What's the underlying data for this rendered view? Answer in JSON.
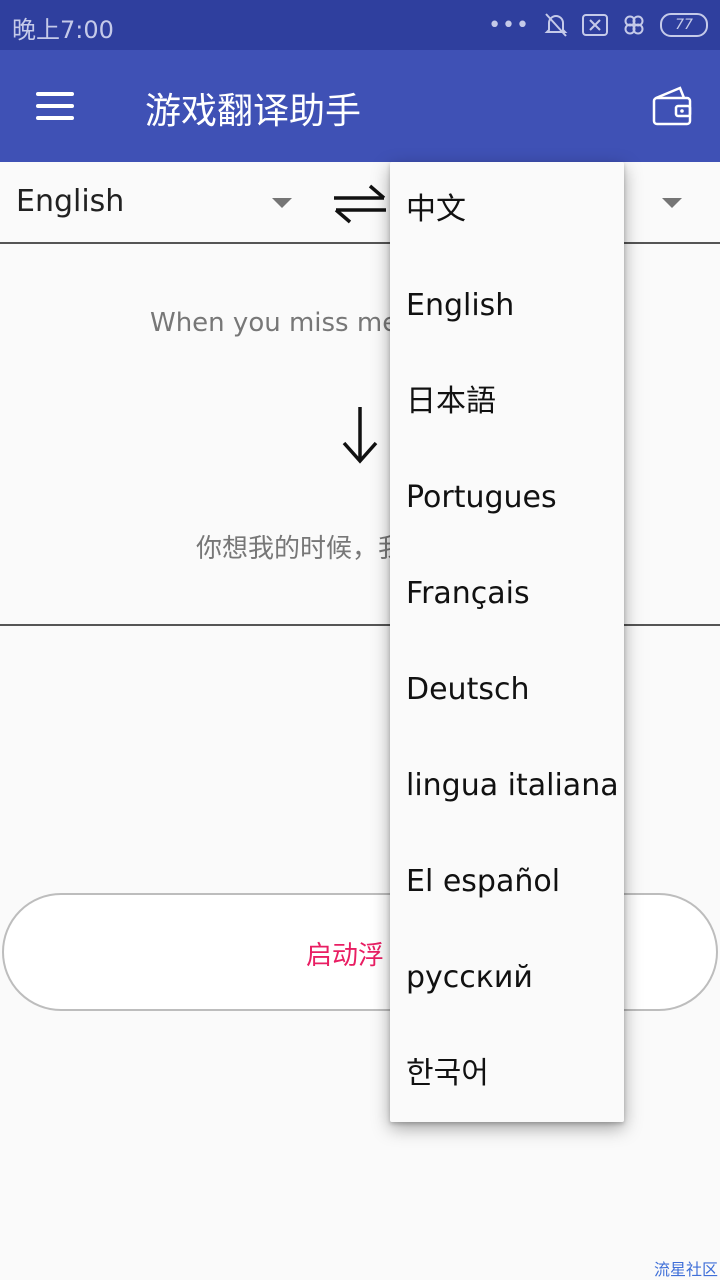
{
  "status_bar": {
    "time": "晚上7:00",
    "battery": "77",
    "icons": [
      "more-dots-icon",
      "mute-bell-icon",
      "sim-x-icon",
      "clover-icon",
      "battery-icon"
    ]
  },
  "toolbar": {
    "title": "游戏翻译助手",
    "menu_icon": "hamburger-menu-icon",
    "right_icon": "wallet-icon",
    "color": "#3f51b5"
  },
  "language_bar": {
    "source_language": "English",
    "swap_icon": "swap-arrows-icon"
  },
  "translation": {
    "source_text": "When you miss me,",
    "arrow_icon": "arrow-down-icon",
    "translated_text": "你想我的时候，我"
  },
  "float_button": {
    "label": "启动浮",
    "accent": "#e91e63"
  },
  "dropdown": {
    "options": [
      "中文",
      "English",
      "日本語",
      "Portugues",
      "Français",
      "Deutsch",
      "lingua italiana",
      "El español",
      "русский",
      "한국어"
    ]
  },
  "watermark": "流星社区"
}
